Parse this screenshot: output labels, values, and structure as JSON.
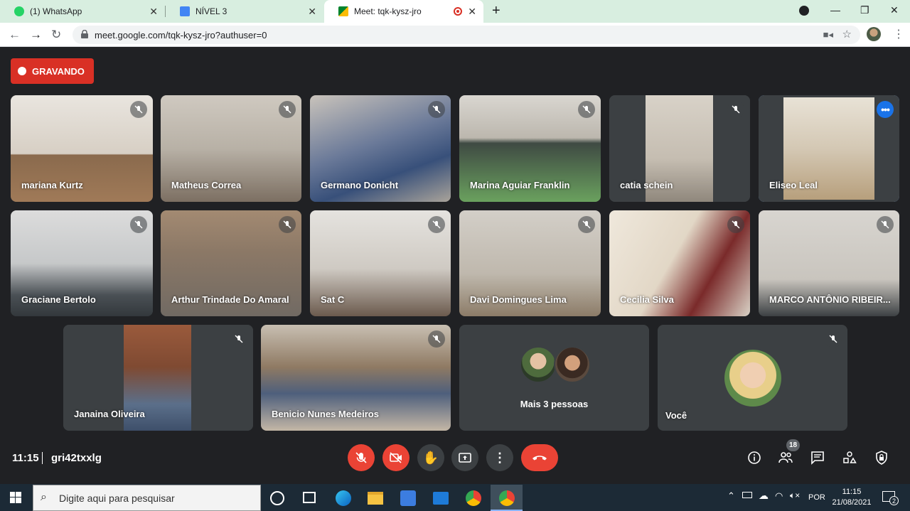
{
  "browser": {
    "tabs": [
      {
        "label": "(1) WhatsApp",
        "fav_color": "#25d366"
      },
      {
        "label": "NÍVEL 3",
        "fav_color": "#4285f4"
      },
      {
        "label": "Meet: tqk-kysz-jro",
        "fav_color": "#00832d"
      }
    ],
    "url": "meet.google.com/tqk-kysz-jro?authuser=0"
  },
  "meet": {
    "recording_label": "GRAVANDO",
    "participants": [
      {
        "name": "mariana Kurtz"
      },
      {
        "name": "Matheus Correa"
      },
      {
        "name": "Germano Donicht"
      },
      {
        "name": "Marina Aguiar Franklin"
      },
      {
        "name": "catia schein"
      },
      {
        "name": "Eliseo Leal"
      },
      {
        "name": "Graciane Bertolo"
      },
      {
        "name": "Arthur Trindade Do Amaral"
      },
      {
        "name": "Sat C"
      },
      {
        "name": "Davi Domingues Lima"
      },
      {
        "name": "Cecilia Silva"
      },
      {
        "name": "MARCO ANTÔNIO RIBEIR..."
      },
      {
        "name": "Janaina Oliveira"
      },
      {
        "name": "Benicio Nunes Medeiros"
      }
    ],
    "more_people_label": "Mais 3 pessoas",
    "self_label": "Você",
    "time": "11:15",
    "meeting_code": "gri42txxlg",
    "participants_count": "18"
  },
  "taskbar": {
    "search_placeholder": "Digite aqui para pesquisar",
    "language": "POR",
    "clock_time": "11:15",
    "clock_date": "21/08/2021",
    "notifications": "2"
  }
}
